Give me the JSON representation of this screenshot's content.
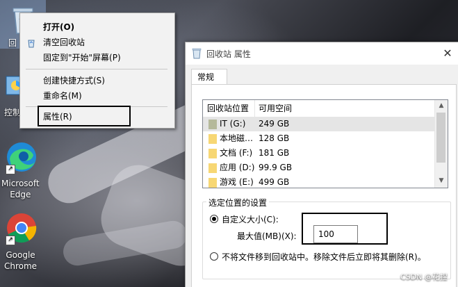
{
  "desktop": {
    "icons": [
      {
        "name": "recycle-bin",
        "label": "回"
      },
      {
        "name": "control-panel",
        "label": "控制"
      },
      {
        "name": "edge",
        "label": "Microsoft\nEdge"
      },
      {
        "name": "chrome",
        "label": "Google\nChrome"
      }
    ]
  },
  "context_menu": {
    "items": [
      "打开(O)",
      "清空回收站",
      "固定到\"开始\"屏幕(P)",
      "创建快捷方式(S)",
      "重命名(M)",
      "属性(R)"
    ]
  },
  "dialog": {
    "title": "回收站 属性",
    "tab": "常规",
    "list": {
      "headers": [
        "回收站位置",
        "可用空间"
      ],
      "rows": [
        {
          "name": "IT (G:)",
          "space": "249 GB"
        },
        {
          "name": "本地磁…",
          "space": "128 GB"
        },
        {
          "name": "文档 (F:)",
          "space": "181 GB"
        },
        {
          "name": "应用 (D:)",
          "space": "99.9 GB"
        },
        {
          "name": "游戏 (E:)",
          "space": "499 GB"
        }
      ]
    },
    "group_label": "选定位置的设置",
    "custom_size": "自定义大小(C):",
    "max_label": "最大值(MB)(X):",
    "max_value": "100",
    "no_move": "不将文件移到回收站中。移除文件后立即将其删除(R)。"
  },
  "watermark": "CSDN @花捏"
}
